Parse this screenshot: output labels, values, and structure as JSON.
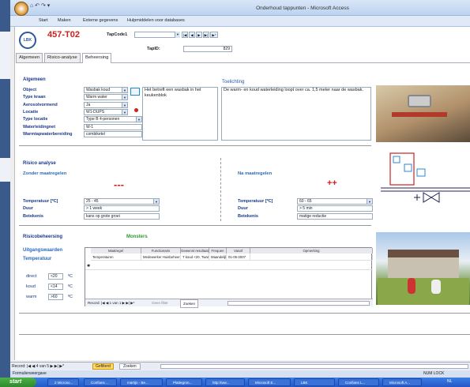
{
  "window": {
    "title": "Onderhoud tappunten - Microsoft Access",
    "quick_access": "⌂ ↶ ↷ ▾"
  },
  "ribbon": {
    "tabs": [
      "Start",
      "Maken",
      "Externe gegevens",
      "Hulpmiddelen voor databases"
    ]
  },
  "form": {
    "code": "457-T02",
    "logo_text": "LBK",
    "tapcode_label": "TapCode1",
    "tapcode_value": "",
    "tapid_label": "TapID:",
    "tapid_value": "829",
    "nav_buttons": [
      "|◀",
      "◀",
      "▶",
      "▶|",
      "▶*"
    ],
    "tabs": [
      "Algemeen",
      "Risico-analyse",
      "Beheersing"
    ],
    "active_tab": "Beheersing"
  },
  "algemeen": {
    "heading": "Algemeen",
    "rows": [
      {
        "label": "Object",
        "value": "Wasbak koud",
        "dropdown": true
      },
      {
        "label": "Type kraan",
        "value": "Warm water",
        "dropdown": true
      },
      {
        "label": "Aerosolvormend",
        "value": "Ja",
        "dropdown": true
      },
      {
        "label": "Locatie",
        "value": "W1-DUPS",
        "dropdown": true
      },
      {
        "label": "Type locatie",
        "value": "Type B 4-personen",
        "dropdown": true
      },
      {
        "label": "Waterleidingnet",
        "value": "W-1",
        "dropdown": false
      },
      {
        "label": "Warmtapwaterbereiding",
        "value": "combiketel",
        "dropdown": false
      }
    ],
    "description": "Het betreft een wasbak in het keukenblok",
    "toelichting_label": "Toelichting",
    "toelichting": "De warm- en koud waterleiding loopt over ca. 1,5 meter naar de wasbak."
  },
  "risico": {
    "heading": "Risico analyse",
    "zonder_label": "Zonder maatregelen",
    "zonder_score": "---",
    "na_label": "Na maatregelen",
    "na_score": "++",
    "zonder_rows": [
      {
        "label": "Temperatuur [ºC]",
        "value": "25 - 45"
      },
      {
        "label": "Duur",
        "value": "> 1 week"
      },
      {
        "label": "Betekenis",
        "value": "kans op grote groei"
      }
    ],
    "na_rows": [
      {
        "label": "Temperatuur [ºC]",
        "value": "60 - 65"
      },
      {
        "label": "Duur",
        "value": "> 5 min"
      },
      {
        "label": "Betekenis",
        "value": "matige reductie"
      }
    ]
  },
  "beheersing": {
    "heading": "Risicobeheersing",
    "monsters": "Monsters",
    "uitgang_label": "Uitgangswaarden",
    "temp_label": "Temperatuur",
    "temps": [
      {
        "label": "direct",
        "value": "<20",
        "unit": "ºC"
      },
      {
        "label": "koud",
        "value": "<14",
        "unit": "ºC"
      },
      {
        "label": "warm",
        "value": ">60",
        "unit": "ºC"
      }
    ],
    "sub_headers": [
      "Maatregel",
      "Functionaris",
      "Gewenst resultaat",
      "Frequen",
      "Vanaf",
      "Opmerking"
    ],
    "sub_row": [
      "Temperaturen",
      "Medewerker Huisbeheer",
      "T koud <20, Twarm >60",
      "Maandelijks",
      "01-05-2007",
      ""
    ],
    "sub_record": "Record: |◀ ◀ 1 van 1 ▶ ▶| ▶*",
    "sub_filter": "Geen filter",
    "sub_search": "Zoeken"
  },
  "status": {
    "record": "Record: |◀ ◀ 4 van 5 ▶ ▶| ▶*",
    "filter": "Gefilterd",
    "search": "Zoeken",
    "view": "Formulierweergave",
    "numlock": "NUM LOCK"
  },
  "taskbar": {
    "start": "start",
    "items": [
      "2 Microso...",
      "Confians ...",
      "martijn - Be...",
      "Plattegron...",
      "http://ww...",
      "Microsoft E...",
      "LBK",
      "Confians L...",
      "Microsoft A..."
    ],
    "clock": "NL"
  },
  "colors": {
    "accent": "#d0201a",
    "brand": "#1a3a8a",
    "monsters": "#2a9a2a"
  }
}
